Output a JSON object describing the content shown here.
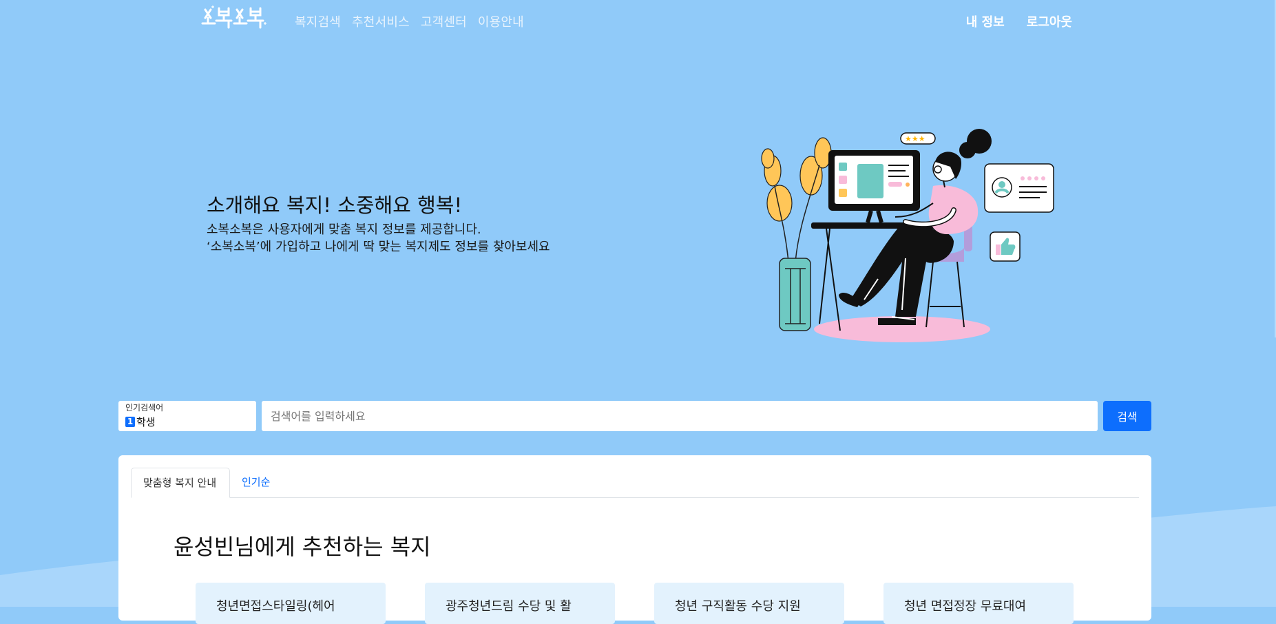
{
  "header": {
    "logo_text": "소복소복",
    "nav": [
      "복지검색",
      "추천서비스",
      "고객센터",
      "이용안내"
    ],
    "user_nav": [
      "내 정보",
      "로그아웃"
    ]
  },
  "hero": {
    "title": "소개해요 복지! 소중해요 행복!",
    "desc_line1": "소복소복은 사용자에게 맞춤 복지 정보를 제공합니다.",
    "desc_line2": "‘소복소복’에 가입하고 나에게 딱 맞는 복지제도 정보를 찾아보세요"
  },
  "search": {
    "popular_label": "인기검색어",
    "popular_rank": "1",
    "popular_term": "학생",
    "placeholder": "검색어를 입력하세요",
    "button_label": "검색"
  },
  "tabs": [
    {
      "label": "맞춤형 복지 안내",
      "active": true
    },
    {
      "label": "인기순",
      "active": false
    }
  ],
  "recommend": {
    "title": "윤성빈님에게 추천하는 복지",
    "cards": [
      "청년면접스타일링(헤어",
      "광주청년드림 수당 및 활",
      "청년 구직활동 수당 지원",
      "청년 면접정장 무료대여"
    ]
  },
  "colors": {
    "background": "#90caf9",
    "accent": "#0d6efd",
    "card_tint": "#e3f2fd"
  }
}
